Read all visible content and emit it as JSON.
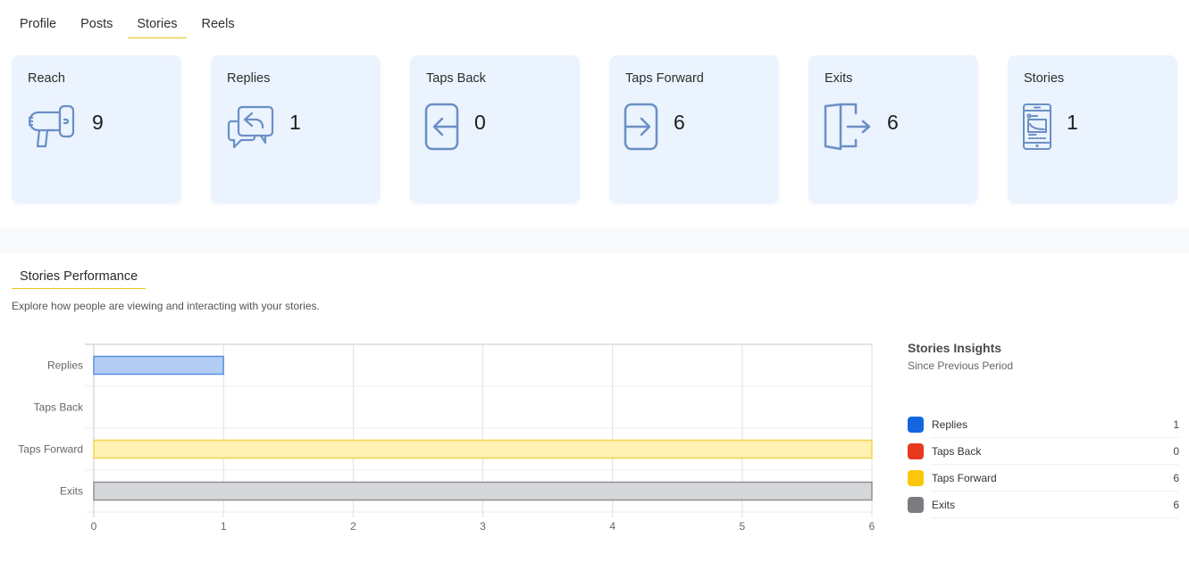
{
  "tabs": [
    {
      "label": "Profile",
      "active": false
    },
    {
      "label": "Posts",
      "active": false
    },
    {
      "label": "Stories",
      "active": true
    },
    {
      "label": "Reels",
      "active": false
    }
  ],
  "cards": [
    {
      "title": "Reach",
      "value": "9",
      "icon": "megaphone-icon"
    },
    {
      "title": "Replies",
      "value": "1",
      "icon": "reply-chat-icon"
    },
    {
      "title": "Taps Back",
      "value": "0",
      "icon": "tap-back-icon"
    },
    {
      "title": "Taps Forward",
      "value": "6",
      "icon": "tap-forward-icon"
    },
    {
      "title": "Exits",
      "value": "6",
      "icon": "exit-door-icon"
    },
    {
      "title": "Stories",
      "value": "1",
      "icon": "phone-story-icon"
    }
  ],
  "colors": {
    "accent": "#e6c619",
    "card_bg": "#ebf3fe",
    "icon": "#6a8fc4"
  },
  "section": {
    "title": "Stories Performance",
    "description": "Explore how people are viewing and interacting with your stories."
  },
  "insights": {
    "title": "Stories Insights",
    "subtitle": "Since Previous Period",
    "items": [
      {
        "label": "Replies",
        "value": "1",
        "color": "#1565e0"
      },
      {
        "label": "Taps Back",
        "value": "0",
        "color": "#e8391e"
      },
      {
        "label": "Taps Forward",
        "value": "6",
        "color": "#fcc70a"
      },
      {
        "label": "Exits",
        "value": "6",
        "color": "#7a7c7f"
      }
    ]
  },
  "chart_data": {
    "type": "bar",
    "orientation": "horizontal",
    "title": "",
    "xlabel": "",
    "ylabel": "",
    "categories": [
      "Replies",
      "Taps Back",
      "Taps Forward",
      "Exits"
    ],
    "values": [
      1,
      0,
      6,
      6
    ],
    "xlim": [
      0,
      6
    ],
    "xticks": [
      "0",
      "1",
      "2",
      "3",
      "4",
      "5",
      "6"
    ],
    "grid": true,
    "bar_fills": [
      "#b3cdf5",
      "#f7c2b8",
      "#fff0b3",
      "#d6d7d9"
    ],
    "bar_strokes": [
      "#5b8fe0",
      "#e8391e",
      "#f5d34a",
      "#8e9093"
    ]
  }
}
